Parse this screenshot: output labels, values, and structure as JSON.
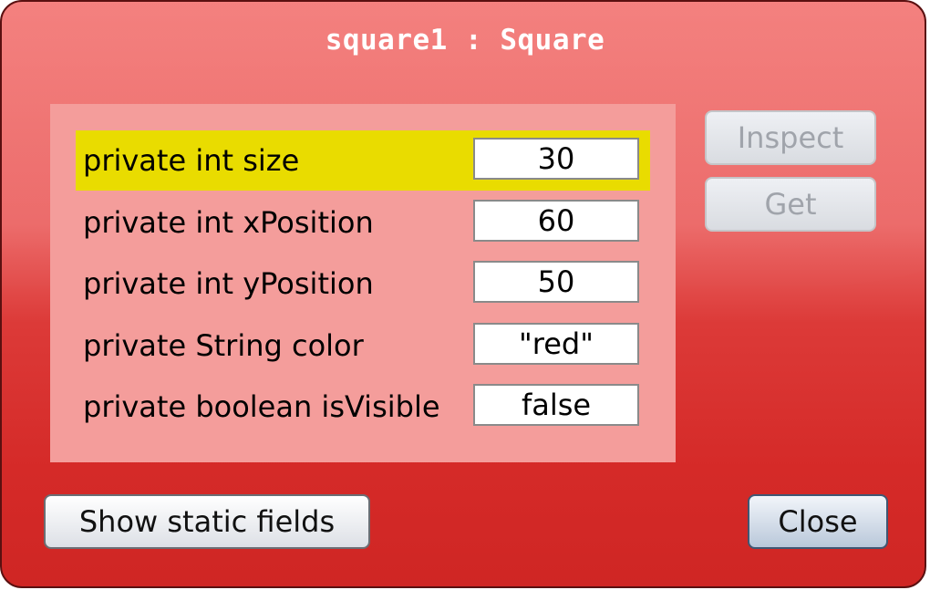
{
  "window": {
    "title": "square1 : Square"
  },
  "fields": [
    {
      "label": "private int size",
      "value": "30",
      "selected": true
    },
    {
      "label": "private int xPosition",
      "value": "60",
      "selected": false
    },
    {
      "label": "private int yPosition",
      "value": "50",
      "selected": false
    },
    {
      "label": "private String color",
      "value": "\"red\"",
      "selected": false
    },
    {
      "label": "private boolean isVisible",
      "value": "false",
      "selected": false
    }
  ],
  "buttons": {
    "inspect_label": "Inspect",
    "get_label": "Get",
    "show_static_label": "Show static fields",
    "close_label": "Close"
  },
  "colors": {
    "window_red": "#dc3a38",
    "panel_pink": "#f49d9b",
    "selection_yellow": "#e9dc00"
  }
}
